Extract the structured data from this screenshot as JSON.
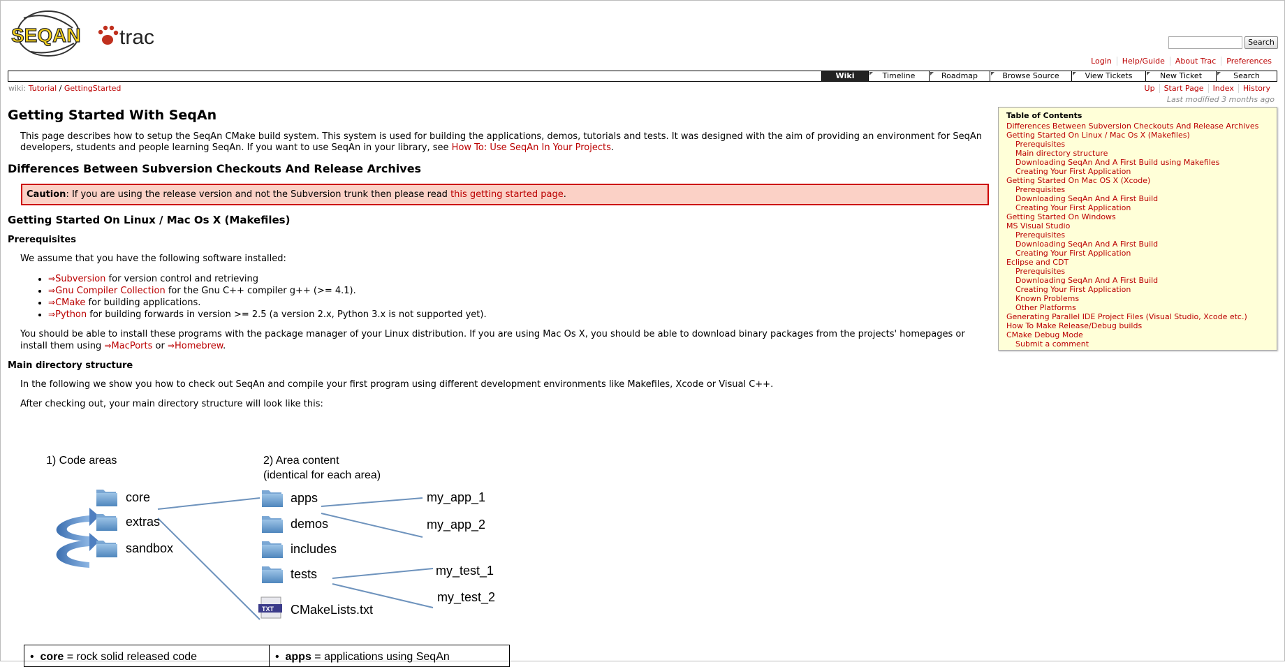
{
  "logo": {
    "seqan_text": "SEQAN",
    "trac_text": "trac"
  },
  "search": {
    "placeholder": "",
    "button_label": "Search"
  },
  "metanav": [
    "Login",
    "Help/Guide",
    "About Trac",
    "Preferences"
  ],
  "mainnav": [
    "Wiki",
    "Timeline",
    "Roadmap",
    "Browse Source",
    "View Tickets",
    "New Ticket",
    "Search"
  ],
  "breadcrumb": {
    "prefix": "wiki:",
    "parent": "Tutorial",
    "sep": "/",
    "current": "GettingStarted"
  },
  "ctxnav": [
    "Up",
    "Start Page",
    "Index",
    "History"
  ],
  "last_modified": "Last modified 3 months ago",
  "page": {
    "title": "Getting Started With SeqAn",
    "intro": "This page describes how to setup the SeqAn CMake build system. This system is used for building the applications, demos, tutorials and tests. It was designed with the aim of providing an environment for SeqAn developers, students and people learning SeqAn. If you want to use SeqAn in your library, see",
    "intro_link": "How To: Use SeqAn In Your Projects",
    "intro_end": ".",
    "h_diff": "Differences Between Subversion Checkouts And Release Archives",
    "caution_label": "Caution",
    "caution_text": ": If you are using the release version and not the Subversion trunk then please read",
    "caution_link": "this getting started page",
    "caution_end": ".",
    "h_linux": "Getting Started On Linux / Mac Os X (Makefiles)",
    "h_prereq": "Prerequisites",
    "prereq_text": "We assume that you have the following software installed:",
    "software": [
      {
        "link": "Subversion",
        "text": " for version control and retrieving"
      },
      {
        "link": "Gnu Compiler Collection",
        "text": " for the Gnu C++ compiler g++ (>= 4.1)."
      },
      {
        "link": "CMake",
        "text": " for building applications."
      },
      {
        "link": "Python",
        "text": " for building forwards in version >= 2.5 (a version 2.x, Python 3.x is not supported yet)."
      }
    ],
    "install_text": "You should be able to install these programs with the package manager of your Linux distribution. If you are using Mac Os X, you should be able to download binary packages from the projects' homepages or install them using",
    "install_link1": "MacPorts",
    "install_or": " or ",
    "install_link2": "Homebrew",
    "install_end": ".",
    "h_maindir": "Main directory structure",
    "maindir_p1": "In the following we show you how to check out SeqAn and compile your first program using different development environments like Makefiles, Xcode or Visual C++.",
    "maindir_p2": "After checking out, your main directory structure will look like this:"
  },
  "toc": {
    "title": "Table of Contents",
    "entries": [
      {
        "level": 1,
        "label": "Differences Between Subversion Checkouts And Release Archives"
      },
      {
        "level": 1,
        "label": "Getting Started On Linux / Mac Os X (Makefiles)"
      },
      {
        "level": 2,
        "label": "Prerequisites"
      },
      {
        "level": 2,
        "label": "Main directory structure"
      },
      {
        "level": 2,
        "label": "Downloading SeqAn And A First Build using Makefiles"
      },
      {
        "level": 2,
        "label": "Creating Your First Application"
      },
      {
        "level": 1,
        "label": "Getting Started On Mac OS X (Xcode)"
      },
      {
        "level": 2,
        "label": "Prerequisites"
      },
      {
        "level": 2,
        "label": "Downloading SeqAn And A First Build"
      },
      {
        "level": 2,
        "label": "Creating Your First Application"
      },
      {
        "level": 1,
        "label": "Getting Started On Windows"
      },
      {
        "level": 1,
        "label": "MS Visual Studio"
      },
      {
        "level": 2,
        "label": "Prerequisites"
      },
      {
        "level": 2,
        "label": "Downloading SeqAn And A First Build"
      },
      {
        "level": 2,
        "label": "Creating Your First Application"
      },
      {
        "level": 1,
        "label": "Eclipse and CDT"
      },
      {
        "level": 2,
        "label": "Prerequisites"
      },
      {
        "level": 2,
        "label": "Downloading SeqAn And A First Build"
      },
      {
        "level": 2,
        "label": "Creating Your First Application"
      },
      {
        "level": 2,
        "label": "Known Problems"
      },
      {
        "level": 2,
        "label": "Other Platforms"
      },
      {
        "level": 1,
        "label": "Generating Parallel IDE Project Files (Visual Studio, Xcode etc.)"
      },
      {
        "level": 1,
        "label": "How To Make Release/Debug builds"
      },
      {
        "level": 1,
        "label": "CMake Debug Mode"
      },
      {
        "level": 2,
        "label": "Submit a comment"
      }
    ]
  },
  "diagram": {
    "heading1": "1) Code areas",
    "heading2_line1": "2) Area content",
    "heading2_line2": "(identical for each area)",
    "areas": [
      "core",
      "extras",
      "sandbox"
    ],
    "content": [
      "apps",
      "demos",
      "includes",
      "tests",
      "CMakeLists.txt"
    ],
    "txt_badge": "TXT",
    "apps_children": [
      "my_app_1",
      "my_app_2"
    ],
    "tests_children": [
      "my_test_1",
      "my_test_2"
    ],
    "table": {
      "left_bold": "core",
      "left_text": " = rock solid released code",
      "right_bold": "apps",
      "right_text": " = applications using SeqAn"
    }
  }
}
